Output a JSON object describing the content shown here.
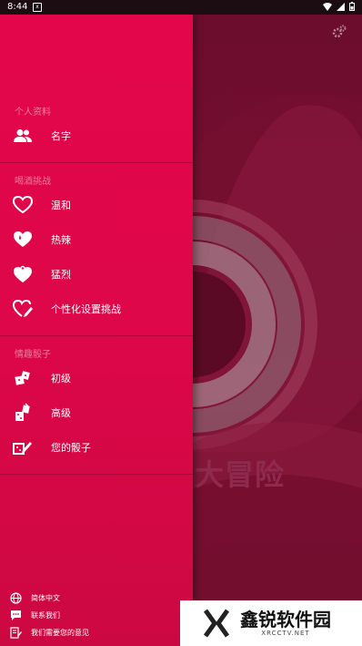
{
  "status_bar": {
    "time": "8:44"
  },
  "app": {
    "title": "大冒险"
  },
  "drawer": {
    "sections": [
      {
        "title": "个人资料",
        "items": [
          {
            "label": "名字",
            "icon": "people-icon"
          }
        ]
      },
      {
        "title": "喝酒挑战",
        "items": [
          {
            "label": "温和",
            "icon": "heart-outline-icon"
          },
          {
            "label": "热辣",
            "icon": "heart-drop-icon"
          },
          {
            "label": "猛烈",
            "icon": "heart-flame-icon"
          },
          {
            "label": "个性化设置挑战",
            "icon": "heart-edit-icon"
          }
        ]
      },
      {
        "title": "情趣骰子",
        "items": [
          {
            "label": "初级",
            "icon": "dice-icon"
          },
          {
            "label": "高级",
            "icon": "dice-advanced-icon"
          },
          {
            "label": "您的骰子",
            "icon": "dice-edit-icon"
          }
        ]
      }
    ],
    "footer": [
      {
        "label": "简体中文",
        "icon": "globe-icon"
      },
      {
        "label": "联系我们",
        "icon": "chat-icon"
      },
      {
        "label": "我们需要您的意见",
        "icon": "feedback-icon"
      }
    ]
  },
  "watermark": {
    "main": "鑫锐软件园",
    "sub": "XRCCTV.NET"
  }
}
